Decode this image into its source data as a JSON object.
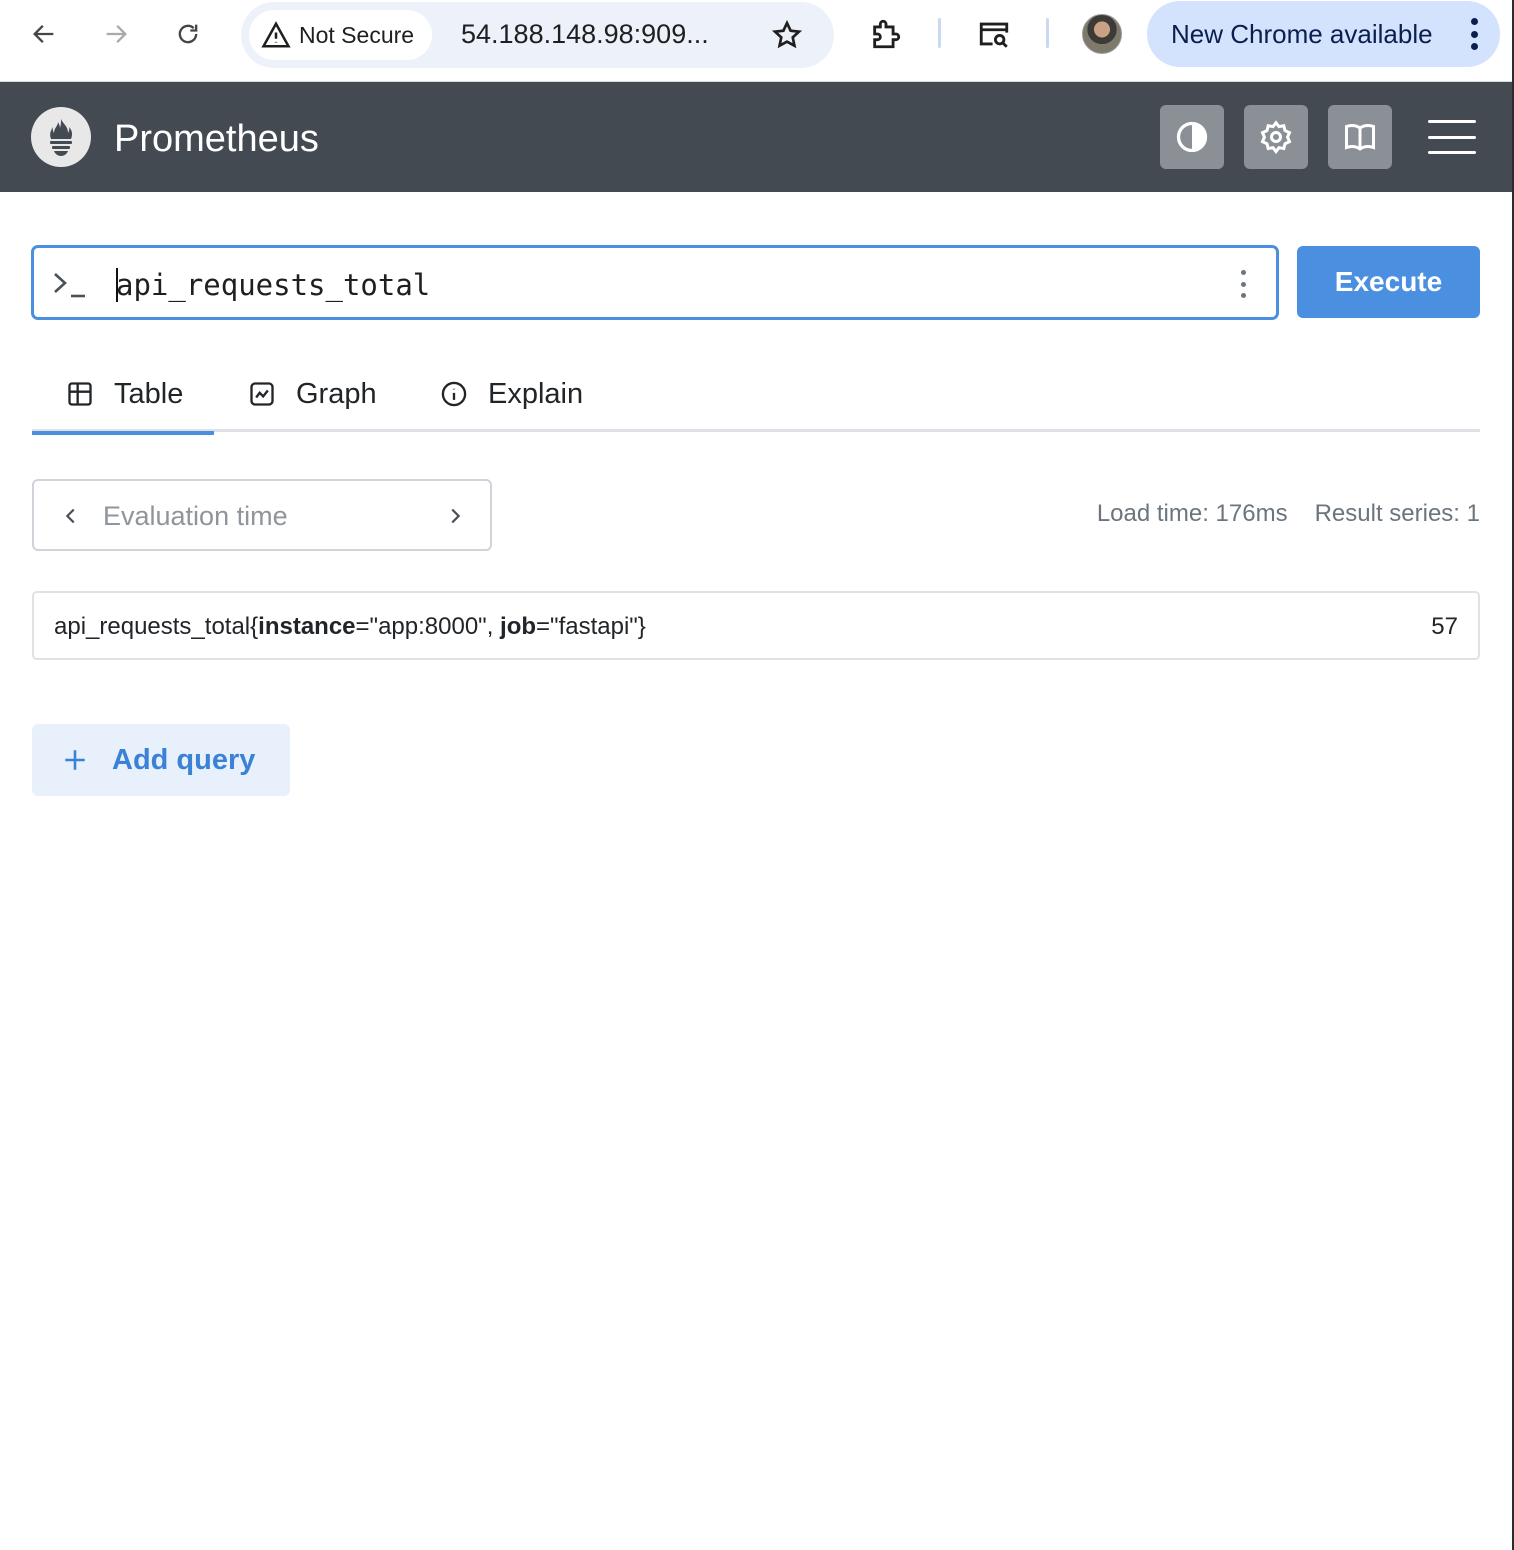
{
  "browser": {
    "security_label": "Not Secure",
    "url": "54.188.148.98:909...",
    "update_label": "New Chrome available"
  },
  "app": {
    "title": "Prometheus",
    "header_buttons": [
      "theme-toggle-icon",
      "settings-icon",
      "docs-book-icon",
      "menu-icon"
    ]
  },
  "query": {
    "expression": "api_requests_total",
    "execute_label": "Execute"
  },
  "tabs": [
    {
      "label": "Table",
      "icon": "table-icon",
      "active": true
    },
    {
      "label": "Graph",
      "icon": "graph-icon",
      "active": false
    },
    {
      "label": "Explain",
      "icon": "info-icon",
      "active": false
    }
  ],
  "evaluation": {
    "placeholder": "Evaluation time",
    "load_time": "Load time: 176ms",
    "result_series": "Result series: 1"
  },
  "results": [
    {
      "metric": "api_requests_total",
      "labels": [
        {
          "name": "instance",
          "value": "\"app:8000\""
        },
        {
          "name": "job",
          "value": "\"fastapi\""
        }
      ],
      "value": "57"
    }
  ],
  "add_query_label": "Add query",
  "colors": {
    "header_bg": "#434a52",
    "accent": "#4a8fe0"
  }
}
